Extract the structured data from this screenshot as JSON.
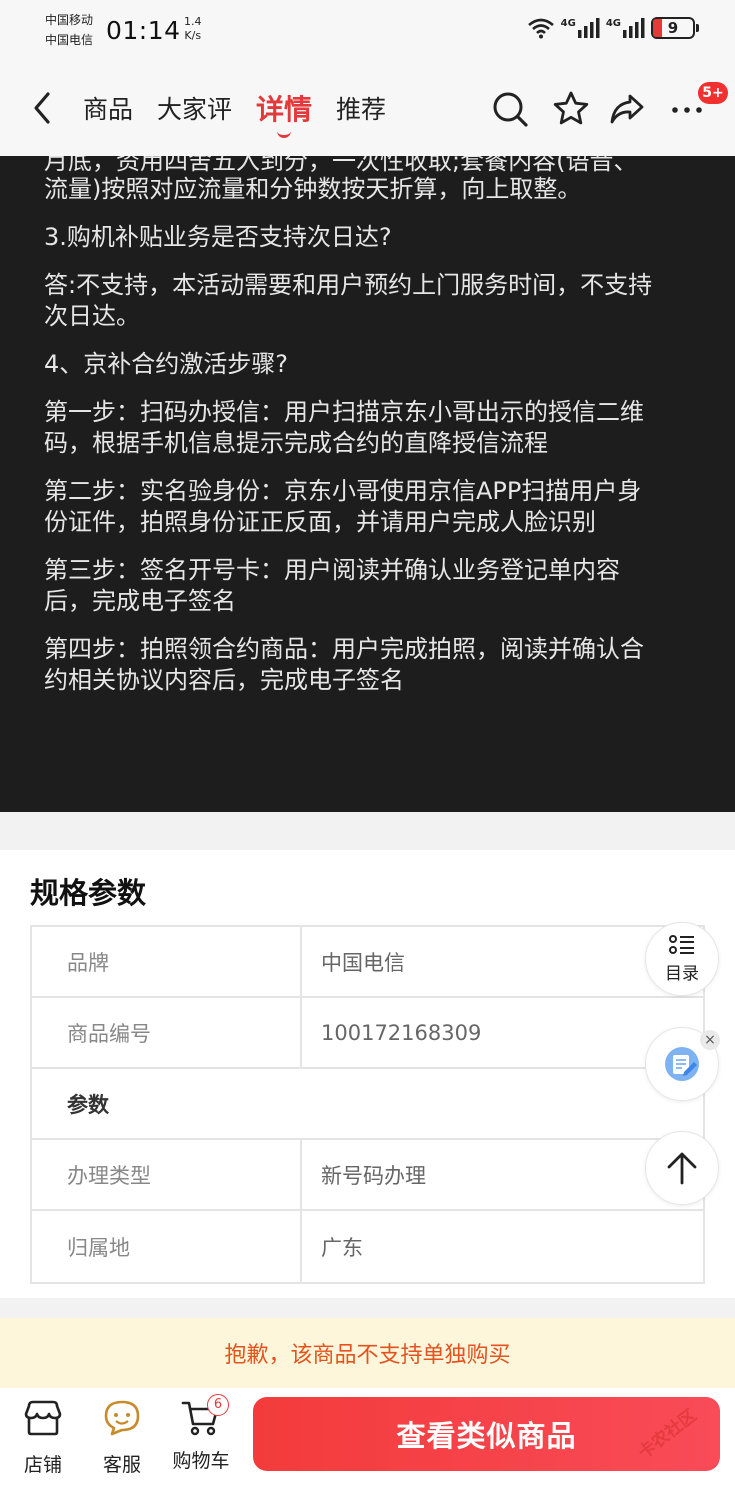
{
  "status_bar": {
    "carrier_1": "中国移动",
    "carrier_2": "中国电信",
    "time": "01:14",
    "speed_value": "1.4",
    "speed_unit": "K/s",
    "network_1": "4G",
    "network_2": "4G",
    "battery": "9"
  },
  "nav": {
    "tabs": [
      {
        "label": "商品"
      },
      {
        "label": "大家评"
      },
      {
        "label": "详情"
      },
      {
        "label": "推荐"
      }
    ],
    "active_tab": "详情",
    "badge": "5+"
  },
  "detail_image": {
    "lines": [
      "月底，资用四舍五入到分，一次性收取;套餐内容(语音、",
      "流量)按照对应流量和分钟数按天折算，向上取整。",
      "3.购机补贴业务是否支持次日达?",
      "答:不支持，本活动需要和用户预约上门服务时间，不支持",
      "次日达。",
      "4、京补合约激活步骤?",
      "第一步：扫码办授信：用户扫描京东小哥出示的授信二维",
      "码，根据手机信息提示完成合约的直降授信流程",
      "第二步：实名验身份：京东小哥使用京信APP扫描用户身",
      "份证件，拍照身份证正反面，并请用户完成人脸识别",
      "第三步：签名开号卡：用户阅读并确认业务登记单内容",
      "后，完成电子签名",
      "第四步：拍照领合约商品：用户完成拍照，阅读并确认合",
      "约相关协议内容后，完成电子签名"
    ]
  },
  "specs": {
    "title": "规格参数",
    "rows": [
      {
        "key": "品牌",
        "value": "中国电信"
      },
      {
        "key": "商品编号",
        "value": "100172168309"
      },
      {
        "group": "参数"
      },
      {
        "key": "办理类型",
        "value": "新号码办理"
      },
      {
        "key": "归属地",
        "value": "广东"
      }
    ]
  },
  "float_buttons": {
    "toc_label": "目录",
    "close": "×"
  },
  "notice": "抱歉，该商品不支持单独购买",
  "bottom_bar": {
    "shop": "店铺",
    "service": "客服",
    "cart": "购物车",
    "cart_count": "6",
    "cta": "查看类似商品"
  },
  "watermark": "卡农社区",
  "colors": {
    "accent": "#e4393c",
    "notice_bg": "#fdf6da",
    "notice_text": "#e4531f",
    "dark_bg": "#1e1d1d"
  }
}
